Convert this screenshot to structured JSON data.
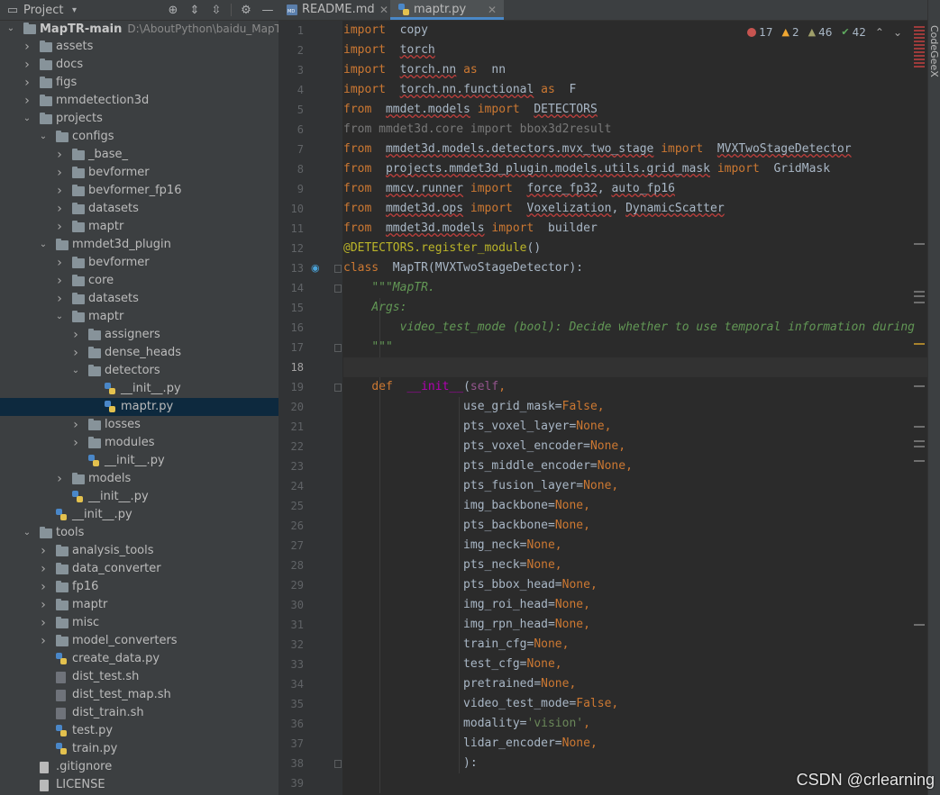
{
  "panel": {
    "title": "Project"
  },
  "tree": [
    {
      "label": "MapTR-main",
      "path": "D:\\AboutPython\\baidu_MapTR\\M",
      "depth": 0,
      "type": "folder",
      "expanded": true,
      "bold": true
    },
    {
      "label": "assets",
      "depth": 1,
      "type": "folder",
      "expanded": false
    },
    {
      "label": "docs",
      "depth": 1,
      "type": "folder",
      "expanded": false
    },
    {
      "label": "figs",
      "depth": 1,
      "type": "folder",
      "expanded": false
    },
    {
      "label": "mmdetection3d",
      "depth": 1,
      "type": "folder",
      "expanded": false
    },
    {
      "label": "projects",
      "depth": 1,
      "type": "folder",
      "expanded": true
    },
    {
      "label": "configs",
      "depth": 2,
      "type": "folder",
      "expanded": true
    },
    {
      "label": "_base_",
      "depth": 3,
      "type": "folder",
      "expanded": false
    },
    {
      "label": "bevformer",
      "depth": 3,
      "type": "folder",
      "expanded": false
    },
    {
      "label": "bevformer_fp16",
      "depth": 3,
      "type": "folder",
      "expanded": false
    },
    {
      "label": "datasets",
      "depth": 3,
      "type": "folder",
      "expanded": false
    },
    {
      "label": "maptr",
      "depth": 3,
      "type": "folder",
      "expanded": false
    },
    {
      "label": "mmdet3d_plugin",
      "depth": 2,
      "type": "folder",
      "expanded": true
    },
    {
      "label": "bevformer",
      "depth": 3,
      "type": "folder",
      "expanded": false
    },
    {
      "label": "core",
      "depth": 3,
      "type": "folder",
      "expanded": false
    },
    {
      "label": "datasets",
      "depth": 3,
      "type": "folder",
      "expanded": false
    },
    {
      "label": "maptr",
      "depth": 3,
      "type": "folder",
      "expanded": true
    },
    {
      "label": "assigners",
      "depth": 4,
      "type": "folder",
      "expanded": false
    },
    {
      "label": "dense_heads",
      "depth": 4,
      "type": "folder",
      "expanded": false
    },
    {
      "label": "detectors",
      "depth": 4,
      "type": "folder",
      "expanded": true
    },
    {
      "label": "__init__.py",
      "depth": 5,
      "type": "py"
    },
    {
      "label": "maptr.py",
      "depth": 5,
      "type": "py",
      "selected": true
    },
    {
      "label": "losses",
      "depth": 4,
      "type": "folder",
      "expanded": false
    },
    {
      "label": "modules",
      "depth": 4,
      "type": "folder",
      "expanded": false
    },
    {
      "label": "__init__.py",
      "depth": 4,
      "type": "py"
    },
    {
      "label": "models",
      "depth": 3,
      "type": "folder",
      "expanded": false
    },
    {
      "label": "__init__.py",
      "depth": 3,
      "type": "py"
    },
    {
      "label": "__init__.py",
      "depth": 2,
      "type": "py"
    },
    {
      "label": "tools",
      "depth": 1,
      "type": "folder",
      "expanded": true
    },
    {
      "label": "analysis_tools",
      "depth": 2,
      "type": "folder",
      "expanded": false
    },
    {
      "label": "data_converter",
      "depth": 2,
      "type": "folder",
      "expanded": false
    },
    {
      "label": "fp16",
      "depth": 2,
      "type": "folder",
      "expanded": false
    },
    {
      "label": "maptr",
      "depth": 2,
      "type": "folder",
      "expanded": false
    },
    {
      "label": "misc",
      "depth": 2,
      "type": "folder",
      "expanded": false
    },
    {
      "label": "model_converters",
      "depth": 2,
      "type": "folder",
      "expanded": false
    },
    {
      "label": "create_data.py",
      "depth": 2,
      "type": "py"
    },
    {
      "label": "dist_test.sh",
      "depth": 2,
      "type": "sh"
    },
    {
      "label": "dist_test_map.sh",
      "depth": 2,
      "type": "sh"
    },
    {
      "label": "dist_train.sh",
      "depth": 2,
      "type": "sh"
    },
    {
      "label": "test.py",
      "depth": 2,
      "type": "py"
    },
    {
      "label": "train.py",
      "depth": 2,
      "type": "py"
    },
    {
      "label": ".gitignore",
      "depth": 1,
      "type": "file"
    },
    {
      "label": "LICENSE",
      "depth": 1,
      "type": "file"
    }
  ],
  "tabs": [
    {
      "label": "README.md",
      "active": false,
      "icon": "markdown-icon"
    },
    {
      "label": "maptr.py",
      "active": true,
      "icon": "python-file-icon"
    }
  ],
  "inspections": {
    "errors": "17",
    "warnings": "2",
    "weak_warnings": "46",
    "typos": "42"
  },
  "current_line": 18,
  "code_lines": [
    [
      [
        "kw",
        "import"
      ],
      [
        "",
        "  copy"
      ]
    ],
    [
      [
        "kw",
        "import"
      ],
      [
        "",
        "  "
      ],
      [
        "sq",
        "torch"
      ]
    ],
    [
      [
        "kw",
        "import"
      ],
      [
        "",
        "  "
      ],
      [
        "sq",
        "torch.nn"
      ],
      [
        "",
        ""
      ],
      [
        "kw",
        " as"
      ],
      [
        "",
        ""
      ],
      [
        "",
        ""
      ],
      [
        "",
        ""
      ],
      [
        "",
        "  nn"
      ]
    ],
    [
      [
        "kw",
        "import"
      ],
      [
        "",
        "  "
      ],
      [
        "sq",
        "torch.nn.functional"
      ],
      [
        "kw",
        " as"
      ],
      [
        "",
        ""
      ],
      [
        "",
        "  F"
      ]
    ],
    [
      [
        "kw",
        "from"
      ],
      [
        "",
        "  "
      ],
      [
        "sq",
        "mmdet.models"
      ],
      [
        "kw",
        " import"
      ],
      [
        "",
        ""
      ],
      [
        "",
        "  "
      ],
      [
        "sq",
        "DETECTORS"
      ]
    ],
    [
      [
        "dim",
        "from mmdet3d.core import bbox3d2result"
      ]
    ],
    [
      [
        "kw",
        "from"
      ],
      [
        "",
        "  "
      ],
      [
        "sq",
        "mmdet3d.models.detectors.mvx_two_stage"
      ],
      [
        "kw",
        " import"
      ],
      [
        "",
        ""
      ],
      [
        "",
        "  "
      ],
      [
        "sq",
        "MVXTwoStageDetector"
      ]
    ],
    [
      [
        "kw",
        "from"
      ],
      [
        "",
        "  "
      ],
      [
        "sq",
        "projects.mmdet3d_plugin.models.utils.grid_mask"
      ],
      [
        "kw",
        " import"
      ],
      [
        "",
        "  GridMask"
      ]
    ],
    [
      [
        "kw",
        "from"
      ],
      [
        "",
        "  "
      ],
      [
        "sq",
        "mmcv.runner"
      ],
      [
        "kw",
        " import"
      ],
      [
        "",
        "  "
      ],
      [
        "sq",
        "force_fp32"
      ],
      [
        "",
        ", "
      ],
      [
        "sq",
        "auto_fp16"
      ]
    ],
    [
      [
        "kw",
        "from"
      ],
      [
        "",
        "  "
      ],
      [
        "sq",
        "mmdet3d.ops"
      ],
      [
        "kw",
        " import"
      ],
      [
        "",
        "  "
      ],
      [
        "sq",
        "Voxelization"
      ],
      [
        "",
        ", "
      ],
      [
        "sq",
        "DynamicScatter"
      ]
    ],
    [
      [
        "kw",
        "from"
      ],
      [
        "",
        "  "
      ],
      [
        "sq",
        "mmdet3d.models"
      ],
      [
        "kw",
        " import"
      ],
      [
        "",
        "  builder"
      ]
    ],
    [
      [
        "deco",
        "@DETECTORS.register_module"
      ],
      [
        "",
        "()"
      ]
    ],
    [
      [
        "kw",
        "class"
      ],
      [
        "",
        "  MapTR(MVXTwoStageDetector):"
      ]
    ],
    [
      [
        "",
        "    "
      ],
      [
        "doc",
        "\"\"\"MapTR."
      ]
    ],
    [
      [
        "",
        "    "
      ],
      [
        "doc",
        "Args:"
      ]
    ],
    [
      [
        "",
        "        "
      ],
      [
        "doc",
        "video_test_mode (bool): Decide whether to use temporal information during"
      ]
    ],
    [
      [
        "",
        "    "
      ],
      [
        "doc",
        "\"\"\""
      ]
    ],
    [
      [
        "",
        ""
      ]
    ],
    [
      [
        "",
        "    "
      ],
      [
        "kw",
        "def"
      ],
      [
        "",
        "  "
      ],
      [
        "dunder",
        "__init__"
      ],
      [
        "",
        "("
      ],
      [
        "self",
        "self"
      ],
      [
        "kw",
        ","
      ]
    ],
    [
      [
        "",
        "                 use_grid_mask="
      ],
      [
        "kw",
        "False,"
      ]
    ],
    [
      [
        "",
        "                 pts_voxel_layer="
      ],
      [
        "kw",
        "None,"
      ]
    ],
    [
      [
        "",
        "                 pts_voxel_encoder="
      ],
      [
        "kw",
        "None,"
      ]
    ],
    [
      [
        "",
        "                 pts_middle_encoder="
      ],
      [
        "kw",
        "None,"
      ]
    ],
    [
      [
        "",
        "                 pts_fusion_layer="
      ],
      [
        "kw",
        "None,"
      ]
    ],
    [
      [
        "",
        "                 img_backbone="
      ],
      [
        "kw",
        "None,"
      ]
    ],
    [
      [
        "",
        "                 pts_backbone="
      ],
      [
        "kw",
        "None,"
      ]
    ],
    [
      [
        "",
        "                 img_neck="
      ],
      [
        "kw",
        "None,"
      ]
    ],
    [
      [
        "",
        "                 pts_neck="
      ],
      [
        "kw",
        "None,"
      ]
    ],
    [
      [
        "",
        "                 pts_bbox_head="
      ],
      [
        "kw",
        "None,"
      ]
    ],
    [
      [
        "",
        "                 img_roi_head="
      ],
      [
        "kw",
        "None,"
      ]
    ],
    [
      [
        "",
        "                 img_rpn_head="
      ],
      [
        "kw",
        "None,"
      ]
    ],
    [
      [
        "",
        "                 train_cfg="
      ],
      [
        "kw",
        "None,"
      ]
    ],
    [
      [
        "",
        "                 test_cfg="
      ],
      [
        "kw",
        "None,"
      ]
    ],
    [
      [
        "",
        "                 pretrained="
      ],
      [
        "kw",
        "None,"
      ]
    ],
    [
      [
        "",
        "                 video_test_mode="
      ],
      [
        "kw",
        "False,"
      ]
    ],
    [
      [
        "",
        "                 modality="
      ],
      [
        "str",
        "'vision'"
      ],
      [
        "kw",
        ","
      ]
    ],
    [
      [
        "",
        "                 lidar_encoder="
      ],
      [
        "kw",
        "None,"
      ]
    ],
    [
      [
        "",
        "                 ):"
      ]
    ],
    [
      [
        "",
        ""
      ]
    ]
  ],
  "right_sidebar": {
    "label": "CodeGeeX"
  },
  "watermark": "CSDN @crlearning",
  "colors": {
    "background": "#2b2b2b",
    "keyword": "#cc7832",
    "docstring": "#629755",
    "selection": "#0d293e",
    "accent": "#4a88c7"
  }
}
